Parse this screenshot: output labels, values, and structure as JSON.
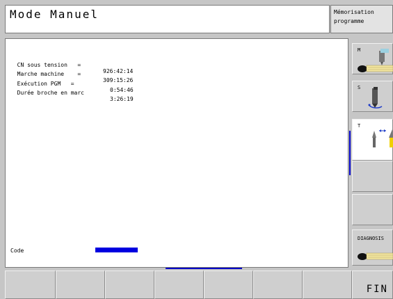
{
  "header": {
    "mode_title": "Mode Manuel",
    "program_line1": "Mémorisation",
    "program_line2": "programme"
  },
  "stats": [
    {
      "label": "CN sous tension   =",
      "value": "926:42:14"
    },
    {
      "label": "Marche machine    =",
      "value": "309:15:26"
    },
    {
      "label": "Exécution PGM   =",
      "value": "0:54:46"
    },
    {
      "label": "Durée broche en marc",
      "value": "3:26:19"
    }
  ],
  "code": {
    "label": "Code"
  },
  "side_softkeys": [
    {
      "label": "M",
      "icon": "machine-function-icon"
    },
    {
      "label": "S",
      "icon": "spindle-icon"
    },
    {
      "label": "T",
      "icon": "tool-call-icon"
    },
    {
      "label": ""
    },
    {
      "label": ""
    },
    {
      "label": "DIAGNOSIS",
      "icon": "diagnosis-icon"
    }
  ],
  "bottom_softkeys": [
    "",
    "",
    "",
    "",
    "",
    "",
    "",
    "FIN"
  ],
  "colors": {
    "accent": "#0000e0",
    "panel": "#ffffff",
    "frame": "#c6c6c6"
  }
}
